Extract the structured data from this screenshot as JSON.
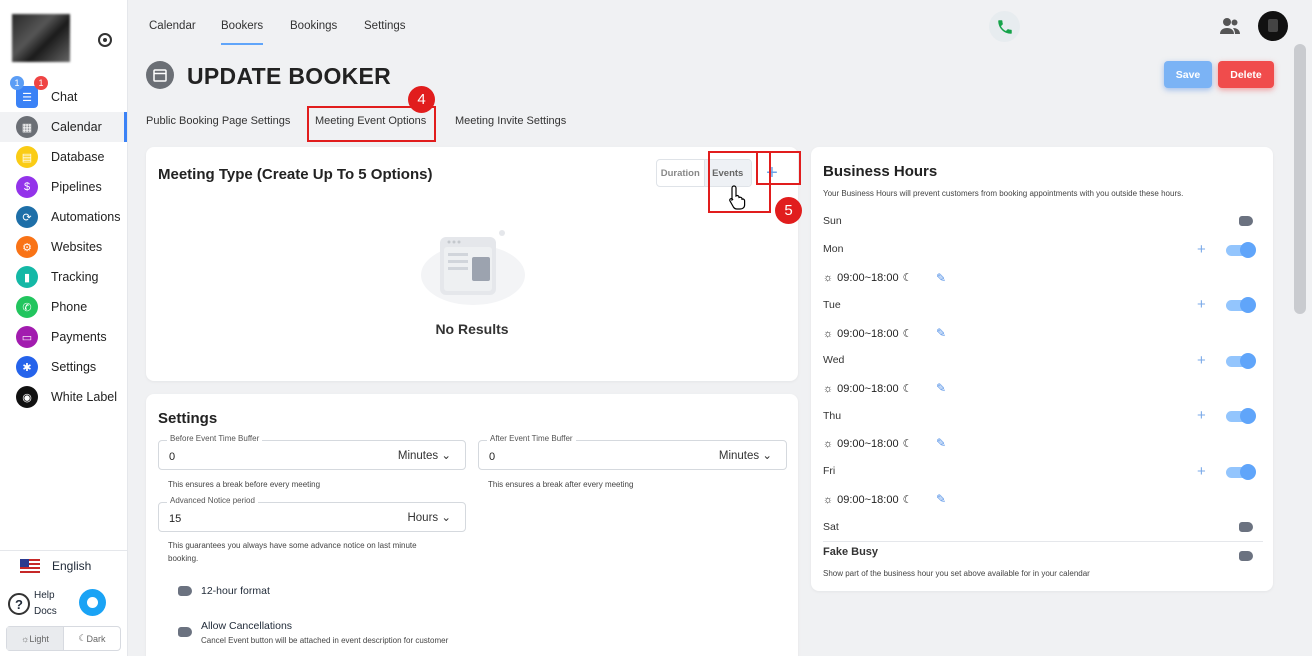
{
  "sidebar": {
    "items": [
      {
        "label": "Chat",
        "icon": "chat-icon",
        "color": "#3b82f6"
      },
      {
        "label": "Calendar",
        "icon": "calendar-icon",
        "color": "#6b6f75"
      },
      {
        "label": "Database",
        "icon": "database-icon",
        "color": "#facc15"
      },
      {
        "label": "Pipelines",
        "icon": "pipelines-icon",
        "color": "#9333ea"
      },
      {
        "label": "Automations",
        "icon": "automations-icon",
        "color": "#1e6fa8"
      },
      {
        "label": "Websites",
        "icon": "websites-icon",
        "color": "#f97316"
      },
      {
        "label": "Tracking",
        "icon": "tracking-icon",
        "color": "#14b8a6"
      },
      {
        "label": "Phone",
        "icon": "phone-icon",
        "color": "#22c55e"
      },
      {
        "label": "Payments",
        "icon": "payments-icon",
        "color": "#a21caf"
      },
      {
        "label": "Settings",
        "icon": "settings-icon",
        "color": "#2563eb"
      },
      {
        "label": "White Label",
        "icon": "palette-icon",
        "color": "#111111"
      }
    ],
    "chat_badges": [
      "1",
      "1"
    ],
    "language": "English",
    "help_label": "Help",
    "docs_label": "Docs",
    "theme_light": "Light",
    "theme_dark": "Dark"
  },
  "topnav": {
    "tabs": [
      "Calendar",
      "Bookers",
      "Bookings",
      "Settings"
    ],
    "active": "Bookers"
  },
  "header": {
    "title": "UPDATE BOOKER",
    "save_label": "Save",
    "delete_label": "Delete"
  },
  "subtabs": [
    "Public Booking Page Settings",
    "Meeting Event Options",
    "Meeting Invite Settings"
  ],
  "annotations": {
    "step_4": "4",
    "step_5": "5"
  },
  "meeting_type": {
    "title": "Meeting Type (Create Up To 5 Options)",
    "seg_duration": "Duration",
    "seg_events": "Events",
    "add": "+",
    "empty": "No Results"
  },
  "settings": {
    "title": "Settings",
    "before_label": "Before Event Time Buffer",
    "before_value": "0",
    "before_unit": "Minutes",
    "before_help": "This ensures a break before every meeting",
    "after_label": "After Event Time Buffer",
    "after_value": "0",
    "after_unit": "Minutes",
    "after_help": "This ensures a break after every meeting",
    "notice_label": "Advanced Notice period",
    "notice_value": "15",
    "notice_unit": "Hours",
    "notice_help_1": "This guarantees you always have some advance notice on last minute",
    "notice_help_2": "booking.",
    "hour12_label": "12-hour format",
    "cancel_label": "Allow Cancellations",
    "cancel_help": "Cancel Event button will be attached in event description for customer"
  },
  "business_hours": {
    "title": "Business Hours",
    "subtitle": "Your Business Hours will prevent customers from booking appointments with you outside these hours.",
    "days": {
      "sun": "Sun",
      "mon": "Mon",
      "tue": "Tue",
      "wed": "Wed",
      "thu": "Thu",
      "fri": "Fri",
      "sat": "Sat"
    },
    "time_range": "09:00~18:00",
    "fake_busy_label": "Fake Busy",
    "fake_busy_help": "Show part of the business hour you set above available for in your calendar"
  }
}
